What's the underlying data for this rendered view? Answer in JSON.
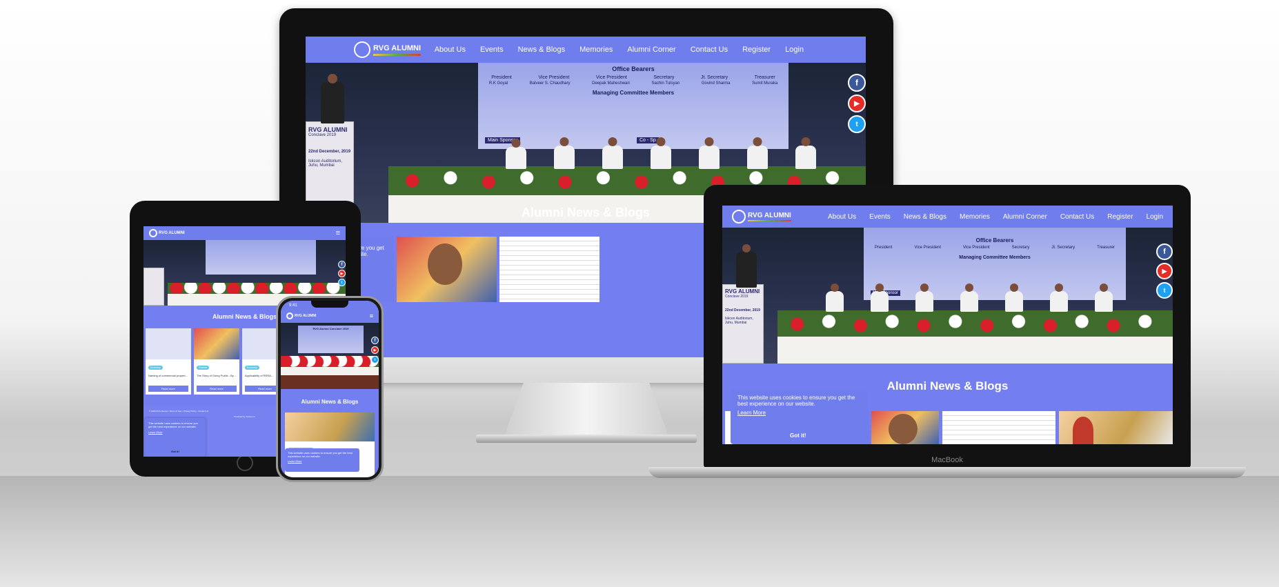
{
  "site": {
    "logo_text": "RVG ALUMNI",
    "nav": [
      "About Us",
      "Events",
      "News & Blogs",
      "Memories",
      "Alumni Corner",
      "Contact Us",
      "Register",
      "Login"
    ],
    "section_title": "Alumni News & Blogs",
    "cookie_text": "This website uses cookies to ensure you get the best experience on our website.",
    "cookie_text_partial": "ses cookies to ensure you get erience on our website.",
    "cookie_link": "Learn More",
    "cookie_button": "Got it!",
    "social": [
      "facebook-icon",
      "youtube-icon",
      "twitter-icon"
    ],
    "hamburger": "≡",
    "phone_time": "9:41",
    "banner": {
      "office_bearers": "Office Bearers",
      "roles": [
        "President",
        "Vice President",
        "Vice President",
        "Secretary",
        "Jt. Secretary",
        "Treasurer"
      ],
      "names": [
        "R.K Goyal",
        "Balveer S. Chaudhary",
        "Deepak Maheshwari",
        "Sachin Tulsyan",
        "Govind Sharma",
        "Sumit Muraka"
      ],
      "committee": "Managing Committee Members",
      "main_sponsor": "Main Sponsor",
      "co_sponsor": "Co - Sp",
      "phone_banner": "RVG Alumni Conclave 2019"
    },
    "podium": {
      "logo": "RVG ALUMNI",
      "sub": "Conclave 2019",
      "date": "22nd December, 2019",
      "venue": "Iskcon Auditorium, Juhu, Mumbai"
    },
    "tablet_cards": [
      {
        "tag": "Economy",
        "title": "Naming of commercial propert...",
        "btn": "Read more"
      },
      {
        "tag": "Finance",
        "title": "The Story of Going Public - By ...",
        "btn": "Read more"
      },
      {
        "tag": "Economy",
        "title": "Applicability of RERA...",
        "btn": "Read more"
      }
    ],
    "tablet_footer": "© 2020 RVG Alumni • Terms of Use • Privacy Policy • Contact Us",
    "tablet_powered": "Powered by rrunner.co",
    "phone_tag": "Uncategorized Blogs",
    "phone_card_title": "Budget FY 2020-21"
  },
  "colors": {
    "brand": "#6f7ded",
    "facebook": "#3b5998",
    "youtube": "#e52d27",
    "twitter": "#1da1f2"
  },
  "devices": {
    "laptop_brand": "MacBook"
  }
}
